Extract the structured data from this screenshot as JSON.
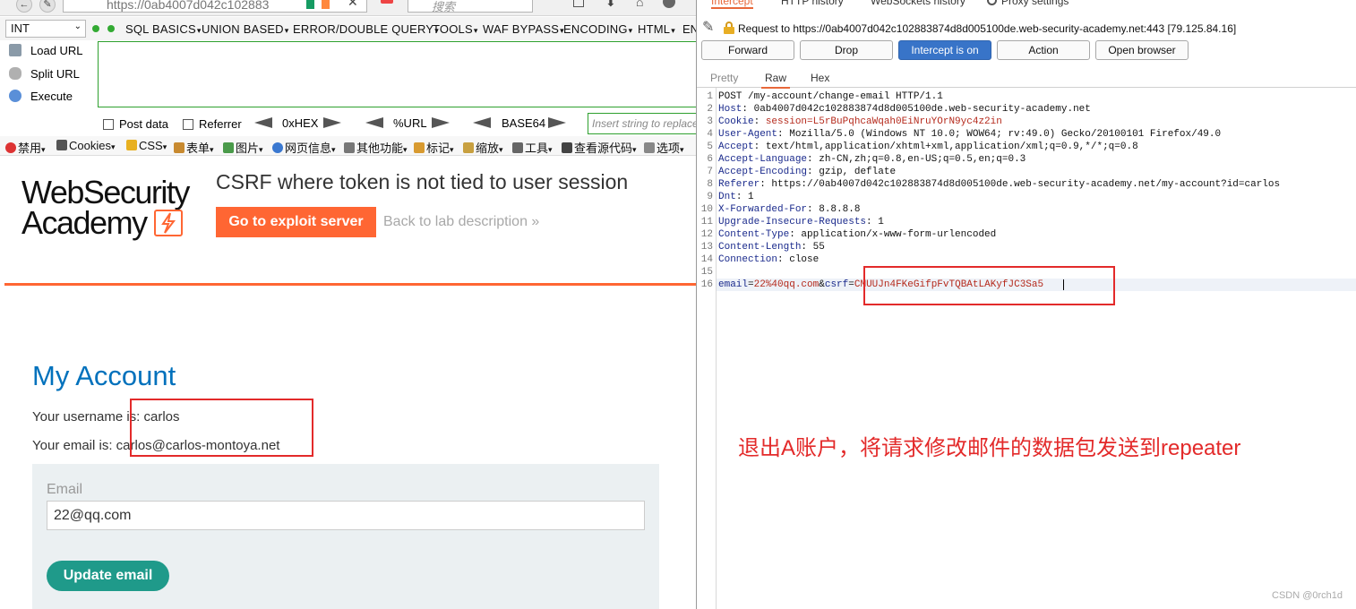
{
  "browser": {
    "url_partial": "https://0ab4007d042c102883",
    "search_placeholder": "搜索"
  },
  "hackbar": {
    "select_value": "INT",
    "menus": [
      "SQL BASICS",
      "UNION BASED",
      "ERROR/DOUBLE QUERY",
      "TOOLS",
      "WAF BYPASS",
      "ENCODING",
      "HTML",
      "EN"
    ],
    "side": [
      "Load URL",
      "Split URL",
      "Execute"
    ],
    "options": {
      "post_data": "Post data",
      "referrer": "Referrer",
      "hex": "0xHEX",
      "url": "%URL",
      "base64": "BASE64",
      "insert_placeholder": "Insert string to replace"
    }
  },
  "bookmarks": [
    "禁用",
    "Cookies",
    "CSS",
    "表单",
    "图片",
    "网页信息",
    "其他功能",
    "标记",
    "缩放",
    "工具",
    "查看源代码",
    "选项"
  ],
  "lab": {
    "logo_line1": "WebSecurity",
    "logo_line2": "Academy",
    "title": "CSRF where token is not tied to user session",
    "exploit_button": "Go to exploit server",
    "back_link": "Back to lab description »",
    "heading": "My Account",
    "username_line": "Your username is: carlos",
    "email_line": "Your email is: carlos@carlos-montoya.net",
    "email_label": "Email",
    "email_value": "22@qq.com",
    "update_button": "Update email"
  },
  "burp": {
    "tabs": [
      "Intercept",
      "HTTP history",
      "WebSockets history",
      "Proxy settings"
    ],
    "active_tab": "Intercept",
    "request_line": "Request to https://0ab4007d042c102883874d8d005100de.web-security-academy.net:443  [79.125.84.16]",
    "buttons": [
      "Forward",
      "Drop",
      "Intercept is on",
      "Action",
      "Open browser"
    ],
    "subtabs": [
      "Pretty",
      "Raw",
      "Hex"
    ],
    "request_lines": [
      {
        "n": "1",
        "key": "",
        "val": "POST /my-account/change-email HTTP/1.1"
      },
      {
        "n": "2",
        "key": "Host",
        "val": "0ab4007d042c102883874d8d005100de.web-security-academy.net"
      },
      {
        "n": "3",
        "key": "Cookie",
        "val": "session=L5rBuPqhcaWqah0EiNruYOrN9yc4z2in"
      },
      {
        "n": "4",
        "key": "User-Agent",
        "val": "Mozilla/5.0 (Windows NT 10.0; WOW64; rv:49.0) Gecko/20100101 Firefox/49.0"
      },
      {
        "n": "5",
        "key": "Accept",
        "val": "text/html,application/xhtml+xml,application/xml;q=0.9,*/*;q=0.8"
      },
      {
        "n": "6",
        "key": "Accept-Language",
        "val": "zh-CN,zh;q=0.8,en-US;q=0.5,en;q=0.3"
      },
      {
        "n": "7",
        "key": "Accept-Encoding",
        "val": "gzip, deflate"
      },
      {
        "n": "8",
        "key": "Referer",
        "val": "https://0ab4007d042c102883874d8d005100de.web-security-academy.net/my-account?id=carlos"
      },
      {
        "n": "9",
        "key": "Dnt",
        "val": "1"
      },
      {
        "n": "10",
        "key": "X-Forwarded-For",
        "val": "8.8.8.8"
      },
      {
        "n": "11",
        "key": "Upgrade-Insecure-Requests",
        "val": "1"
      },
      {
        "n": "12",
        "key": "Content-Type",
        "val": "application/x-www-form-urlencoded"
      },
      {
        "n": "13",
        "key": "Content-Length",
        "val": "55"
      },
      {
        "n": "14",
        "key": "Connection",
        "val": "close"
      },
      {
        "n": "15",
        "key": "",
        "val": ""
      },
      {
        "n": "16",
        "key": "",
        "val": "email=22%40qq.com&csrf=CMUUJn4FKeGifpFvTQBAtLAKyfJC3Sa5"
      }
    ],
    "annotation": "退出A账户，将请求修改邮件的数据包发送到repeater",
    "watermark": "CSDN @0rch1d"
  }
}
